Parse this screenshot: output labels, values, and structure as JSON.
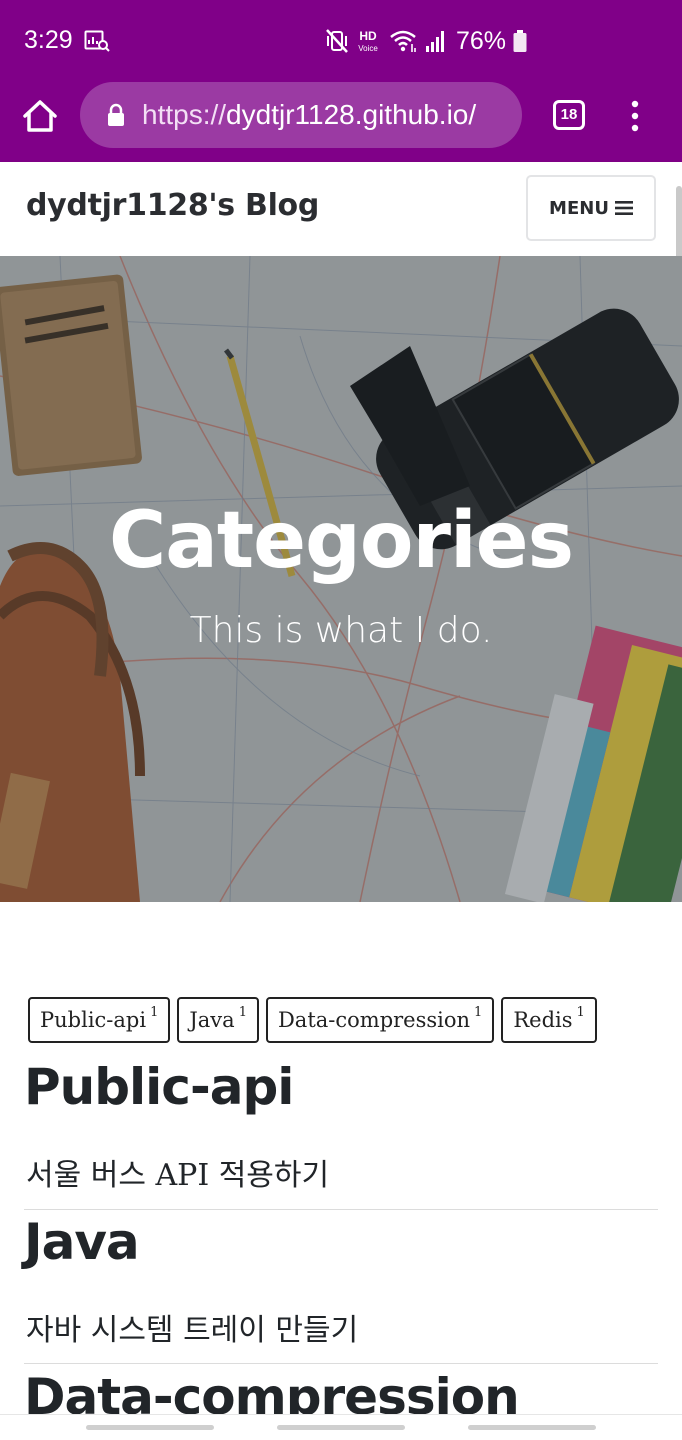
{
  "status_bar": {
    "time": "3:29",
    "hd_label": "HD",
    "voice_label": "Voice",
    "battery": "76%",
    "icons": [
      "screen-recorder-icon",
      "vibrate-mute-icon",
      "hd-voice-icon",
      "wifi-icon",
      "signal-icon",
      "battery-icon"
    ]
  },
  "browser": {
    "url_scheme": "https://",
    "url_host": "dydtjr1128.github.io/",
    "tab_count": "18",
    "icons": [
      "home-icon",
      "lock-icon",
      "tabs-icon",
      "kebab-menu-icon"
    ]
  },
  "navbar": {
    "brand": "dydtjr1128's Blog",
    "menu_label": "MENU"
  },
  "hero": {
    "title": "Categories",
    "subtitle": "This is what I do."
  },
  "tags": [
    {
      "label": "Public-api",
      "count": "1"
    },
    {
      "label": "Java",
      "count": "1"
    },
    {
      "label": "Data-compression",
      "count": "1"
    },
    {
      "label": "Redis",
      "count": "1"
    }
  ],
  "categories": [
    {
      "title": "Public-api",
      "post": "서울 버스 API 적용하기"
    },
    {
      "title": "Java",
      "post": "자바 시스템 트레이 만들기"
    },
    {
      "title": "Data-compression"
    }
  ],
  "colors": {
    "browser_chrome": "#800088",
    "url_pill": "#9b3aa3",
    "text_dark": "#212529"
  }
}
